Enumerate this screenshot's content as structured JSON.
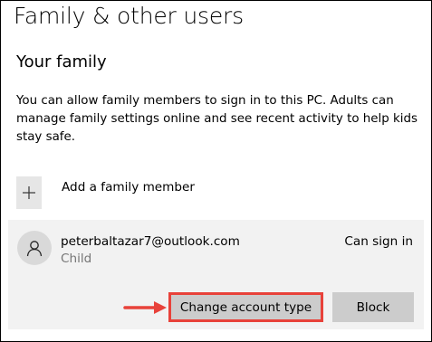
{
  "page": {
    "title": "Family & other users"
  },
  "family": {
    "heading": "Your family",
    "description": "You can allow family members to sign in to this PC. Adults can manage family settings online and see recent activity to help kids stay safe.",
    "add_member_label": "Add a family member",
    "add_icon": "plus-icon"
  },
  "member": {
    "email": "peterbaltazar7@outlook.com",
    "role": "Child",
    "status": "Can sign in",
    "avatar_icon": "person-icon",
    "buttons": {
      "change_account_type": "Change account type",
      "block": "Block"
    }
  },
  "colors": {
    "highlight": "#e8423a",
    "card_background": "#f2f2f2",
    "button_background": "#cccccc",
    "secondary_text": "#767676"
  }
}
